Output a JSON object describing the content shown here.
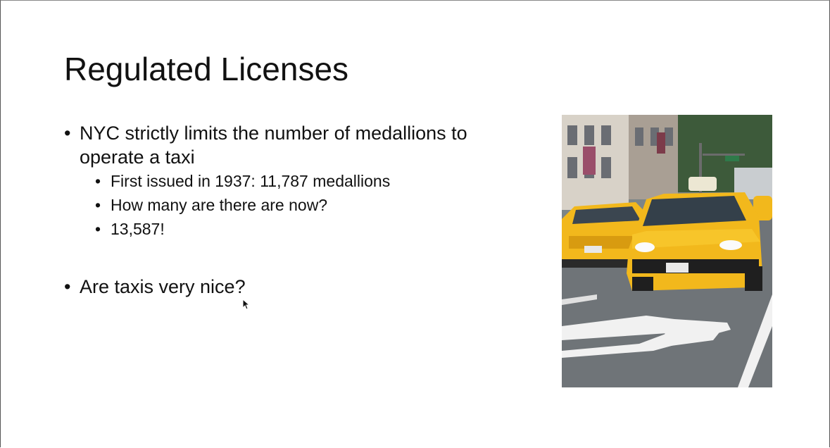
{
  "slide": {
    "title": "Regulated Licenses",
    "bullets": [
      {
        "text": "NYC strictly limits the number of medallions to operate a taxi",
        "sub": [
          "First issued in 1937: 11,787 medallions",
          "How many are there are now?",
          "13,587!"
        ]
      },
      {
        "text": "Are taxis very nice?"
      }
    ],
    "bullet_glyph": "•"
  },
  "image": {
    "icon": "taxi-street-photo"
  },
  "colors": {
    "text": "#111111",
    "background": "#ffffff",
    "taxi_yellow": "#f2b81c"
  }
}
